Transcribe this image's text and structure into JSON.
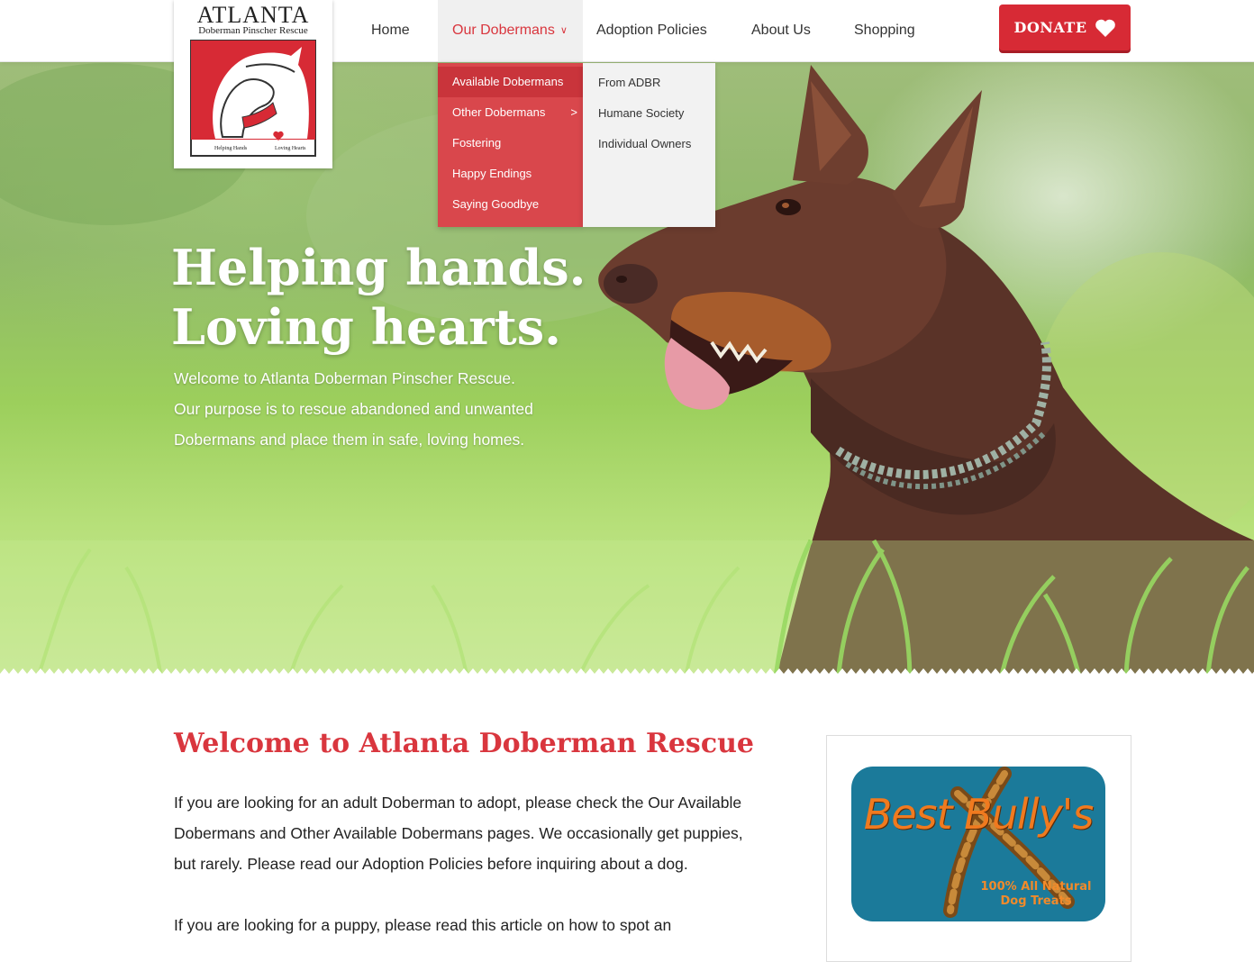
{
  "nav": {
    "items": [
      "Home",
      "Our Dobermans",
      "Adoption Policies",
      "About Us",
      "Shopping"
    ],
    "active_index": 1,
    "donate_label": "DONATE"
  },
  "logo": {
    "title": "ATLANTA",
    "subtitle": "Doberman Pinscher Rescue",
    "tagline_left": "Helping Hands",
    "tagline_right": "Loving Hearts"
  },
  "dropdown": {
    "items": [
      "Available Dobermans",
      "Other Dobermans",
      "Fostering",
      "Happy Endings",
      "Saying Goodbye"
    ],
    "highlighted_index": 0,
    "submenu_parent_index": 1,
    "submenu": [
      "From ADBR",
      "Humane Society",
      "Individual Owners"
    ]
  },
  "hero": {
    "title_line1": "Helping hands.",
    "title_line2": "Loving hearts.",
    "text_lines": [
      "Welcome to Atlanta Doberman Pinscher Rescue.",
      "Our purpose is to rescue abandoned and unwanted",
      "Dobermans and place them in safe, loving homes."
    ]
  },
  "content": {
    "title": "Welcome to Atlanta Doberman Rescue",
    "paragraph1_lines": [
      "If you are looking for an adult Doberman to adopt, please check the Our Available",
      "Dobermans and Other Available Dobermans pages. We occasionally get puppies,",
      "but rarely. Please read our Adoption Policies before inquiring about a dog."
    ],
    "paragraph2_lines": [
      "If you are looking for a puppy, please read this article on how to spot an"
    ]
  },
  "sidebar": {
    "ad_brand": "Best Bully's",
    "ad_tagline_line1": "100% All Natural",
    "ad_tagline_line2": "Dog Treats"
  },
  "colors": {
    "brand_red": "#d72a35",
    "dropdown_red": "#d9474c",
    "dropdown_highlight": "#c9343b",
    "submenu_bg": "#f2f2f2",
    "ad_blue": "#1b7a9a",
    "ad_orange": "#f07a1f"
  }
}
